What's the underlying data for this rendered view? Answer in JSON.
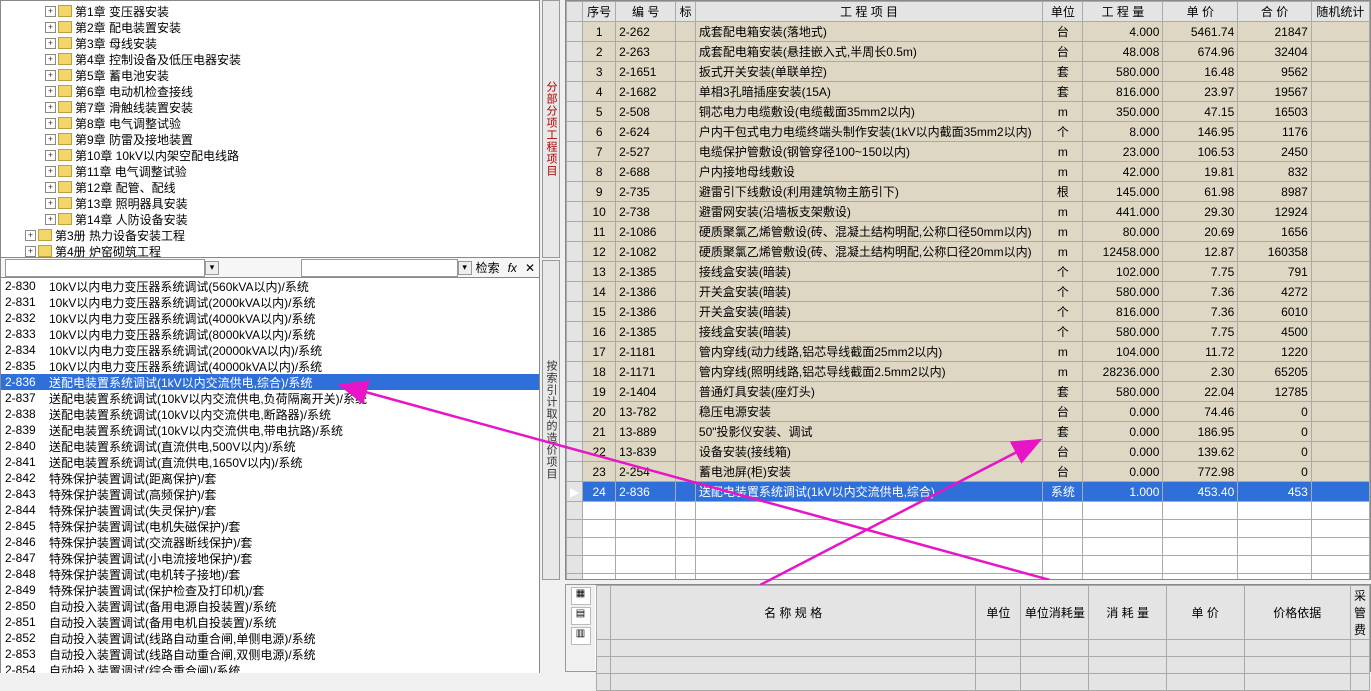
{
  "search": {
    "label": "检索",
    "fx": "fx"
  },
  "tree": [
    {
      "ind": 40,
      "label": "第1章  变压器安装"
    },
    {
      "ind": 40,
      "label": "第2章  配电装置安装"
    },
    {
      "ind": 40,
      "label": "第3章  母线安装"
    },
    {
      "ind": 40,
      "label": "第4章  控制设备及低压电器安装"
    },
    {
      "ind": 40,
      "label": "第5章  蓄电池安装"
    },
    {
      "ind": 40,
      "label": "第6章  电动机检查接线"
    },
    {
      "ind": 40,
      "label": "第7章  滑触线装置安装"
    },
    {
      "ind": 40,
      "label": "第8章  电气调整试验"
    },
    {
      "ind": 40,
      "label": "第9章  防雷及接地装置"
    },
    {
      "ind": 40,
      "label": "第10章  10kV以内架空配电线路"
    },
    {
      "ind": 40,
      "label": "第11章  电气调整试验"
    },
    {
      "ind": 40,
      "label": "第12章  配管、配线"
    },
    {
      "ind": 40,
      "label": "第13章  照明器具安装"
    },
    {
      "ind": 40,
      "label": "第14章  人防设备安装"
    },
    {
      "ind": 20,
      "label": "第3册  热力设备安装工程"
    },
    {
      "ind": 20,
      "label": "第4册  炉窑砌筑工程"
    }
  ],
  "list": [
    {
      "code": "2-830",
      "name": "10kV以内电力变压器系统调试(560kVA以内)/系统"
    },
    {
      "code": "2-831",
      "name": "10kV以内电力变压器系统调试(2000kVA以内)/系统"
    },
    {
      "code": "2-832",
      "name": "10kV以内电力变压器系统调试(4000kVA以内)/系统"
    },
    {
      "code": "2-833",
      "name": "10kV以内电力变压器系统调试(8000kVA以内)/系统"
    },
    {
      "code": "2-834",
      "name": "10kV以内电力变压器系统调试(20000kVA以内)/系统"
    },
    {
      "code": "2-835",
      "name": "10kV以内电力变压器系统调试(40000kVA以内)/系统"
    },
    {
      "code": "2-836",
      "name": "送配电装置系统调试(1kV以内交流供电,综合)/系统",
      "sel": true
    },
    {
      "code": "2-837",
      "name": "送配电装置系统调试(10kV以内交流供电,负荷隔离开关)/系统"
    },
    {
      "code": "2-838",
      "name": "送配电装置系统调试(10kV以内交流供电,断路器)/系统"
    },
    {
      "code": "2-839",
      "name": "送配电装置系统调试(10kV以内交流供电,带电抗路)/系统"
    },
    {
      "code": "2-840",
      "name": "送配电装置系统调试(直流供电,500V以内)/系统"
    },
    {
      "code": "2-841",
      "name": "送配电装置系统调试(直流供电,1650V以内)/系统"
    },
    {
      "code": "2-842",
      "name": "特殊保护装置调试(距离保护)/套"
    },
    {
      "code": "2-843",
      "name": "特殊保护装置调试(高频保护)/套"
    },
    {
      "code": "2-844",
      "name": "特殊保护装置调试(失灵保护)/套"
    },
    {
      "code": "2-845",
      "name": "特殊保护装置调试(电机失磁保护)/套"
    },
    {
      "code": "2-846",
      "name": "特殊保护装置调试(交流器断线保护)/套"
    },
    {
      "code": "2-847",
      "name": "特殊保护装置调试(小电流接地保护)/套"
    },
    {
      "code": "2-848",
      "name": "特殊保护装置调试(电机转子接地)/套"
    },
    {
      "code": "2-849",
      "name": "特殊保护装置调试(保护检查及打印机)/套"
    },
    {
      "code": "2-850",
      "name": "自动投入装置调试(备用电源自投装置)/系统"
    },
    {
      "code": "2-851",
      "name": "自动投入装置调试(备用电机自投装置)/系统"
    },
    {
      "code": "2-852",
      "name": "自动投入装置调试(线路自动重合闸,单侧电源)/系统"
    },
    {
      "code": "2-853",
      "name": "自动投入装置调试(线路自动重合闸,双侧电源)/系统"
    },
    {
      "code": "2-854",
      "name": "自动投入装置调试(综合重合闸)/系统"
    }
  ],
  "vtabs": {
    "t1": "分部分项工程项目",
    "t2": "按索引计取的造价项目"
  },
  "gridH": {
    "seq": "序号",
    "code": "编  号",
    "mark": "标",
    "name": "工  程  项  目",
    "unit": "单位",
    "qty": "工  程  量",
    "price": "单  价",
    "total": "合  价",
    "rand": "随机统计"
  },
  "rows": [
    {
      "s": 1,
      "c": "2-262",
      "n": "成套配电箱安装(落地式)",
      "u": "台",
      "q": "4.000",
      "p": "5461.74",
      "t": "21847"
    },
    {
      "s": 2,
      "c": "2-263",
      "n": "成套配电箱安装(悬挂嵌入式,半周长0.5m)",
      "u": "台",
      "q": "48.008",
      "p": "674.96",
      "t": "32404"
    },
    {
      "s": 3,
      "c": "2-1651",
      "n": "扳式开关安装(单联单控)",
      "u": "套",
      "q": "580.000",
      "p": "16.48",
      "t": "9562"
    },
    {
      "s": 4,
      "c": "2-1682",
      "n": "单相3孔暗插座安装(15A)",
      "u": "套",
      "q": "816.000",
      "p": "23.97",
      "t": "19567"
    },
    {
      "s": 5,
      "c": "2-508",
      "n": "铜芯电力电缆敷设(电缆截面35mm2以内)",
      "u": "m",
      "q": "350.000",
      "p": "47.15",
      "t": "16503"
    },
    {
      "s": 6,
      "c": "2-624",
      "n": "户内干包式电力电缆终端头制作安装(1kV以内截面35mm2以内)",
      "u": "个",
      "q": "8.000",
      "p": "146.95",
      "t": "1176"
    },
    {
      "s": 7,
      "c": "2-527",
      "n": "电缆保护管敷设(钢管穿径100~150以内)",
      "u": "m",
      "q": "23.000",
      "p": "106.53",
      "t": "2450"
    },
    {
      "s": 8,
      "c": "2-688",
      "n": "户内接地母线敷设",
      "u": "m",
      "q": "42.000",
      "p": "19.81",
      "t": "832"
    },
    {
      "s": 9,
      "c": "2-735",
      "n": "避雷引下线敷设(利用建筑物主筋引下)",
      "u": "根",
      "q": "145.000",
      "p": "61.98",
      "t": "8987"
    },
    {
      "s": 10,
      "c": "2-738",
      "n": "避雷网安装(沿墙板支架敷设)",
      "u": "m",
      "q": "441.000",
      "p": "29.30",
      "t": "12924"
    },
    {
      "s": 11,
      "c": "2-1086",
      "n": "硬质聚氯乙烯管敷设(砖、混凝土结构明配,公称口径50mm以内)",
      "u": "m",
      "q": "80.000",
      "p": "20.69",
      "t": "1656"
    },
    {
      "s": 12,
      "c": "2-1082",
      "n": "硬质聚氯乙烯管敷设(砖、混凝土结构明配,公称口径20mm以内)",
      "u": "m",
      "q": "12458.000",
      "p": "12.87",
      "t": "160358"
    },
    {
      "s": 13,
      "c": "2-1385",
      "n": "接线盒安装(暗装)",
      "u": "个",
      "q": "102.000",
      "p": "7.75",
      "t": "791"
    },
    {
      "s": 14,
      "c": "2-1386",
      "n": "开关盒安装(暗装)",
      "u": "个",
      "q": "580.000",
      "p": "7.36",
      "t": "4272"
    },
    {
      "s": 15,
      "c": "2-1386",
      "n": "开关盒安装(暗装)",
      "u": "个",
      "q": "816.000",
      "p": "7.36",
      "t": "6010"
    },
    {
      "s": 16,
      "c": "2-1385",
      "n": "接线盒安装(暗装)",
      "u": "个",
      "q": "580.000",
      "p": "7.75",
      "t": "4500"
    },
    {
      "s": 17,
      "c": "2-1181",
      "n": "管内穿线(动力线路,铝芯导线截面25mm2以内)",
      "u": "m",
      "q": "104.000",
      "p": "11.72",
      "t": "1220"
    },
    {
      "s": 18,
      "c": "2-1171",
      "n": "管内穿线(照明线路,铝芯导线截面2.5mm2以内)",
      "u": "m",
      "q": "28236.000",
      "p": "2.30",
      "t": "65205"
    },
    {
      "s": 19,
      "c": "2-1404",
      "n": "普通灯具安装(座灯头)",
      "u": "套",
      "q": "580.000",
      "p": "22.04",
      "t": "12785"
    },
    {
      "s": 20,
      "c": "13-782",
      "n": "稳压电源安装",
      "u": "台",
      "q": "0.000",
      "p": "74.46",
      "t": "0"
    },
    {
      "s": 21,
      "c": "13-889",
      "n": "50\"投影仪安装、调试",
      "u": "套",
      "q": "0.000",
      "p": "186.95",
      "t": "0"
    },
    {
      "s": 22,
      "c": "13-839",
      "n": "设备安装(接线箱)",
      "u": "台",
      "q": "0.000",
      "p": "139.62",
      "t": "0"
    },
    {
      "s": 23,
      "c": "2-254",
      "n": "蓄电池屏(柜)安装",
      "u": "台",
      "q": "0.000",
      "p": "772.98",
      "t": "0"
    },
    {
      "s": 24,
      "c": "2-836",
      "n": "送配电装置系统调试(1kV以内交流供电,综合)",
      "u": "系统",
      "q": "1.000",
      "p": "453.40",
      "t": "453",
      "hl": true
    }
  ],
  "bH": {
    "name": "名  称  规  格",
    "unit": "单位",
    "cons": "单位消耗量",
    "qty": "消  耗  量",
    "price": "单  价",
    "basis": "价格依据",
    "src": "采管费"
  }
}
